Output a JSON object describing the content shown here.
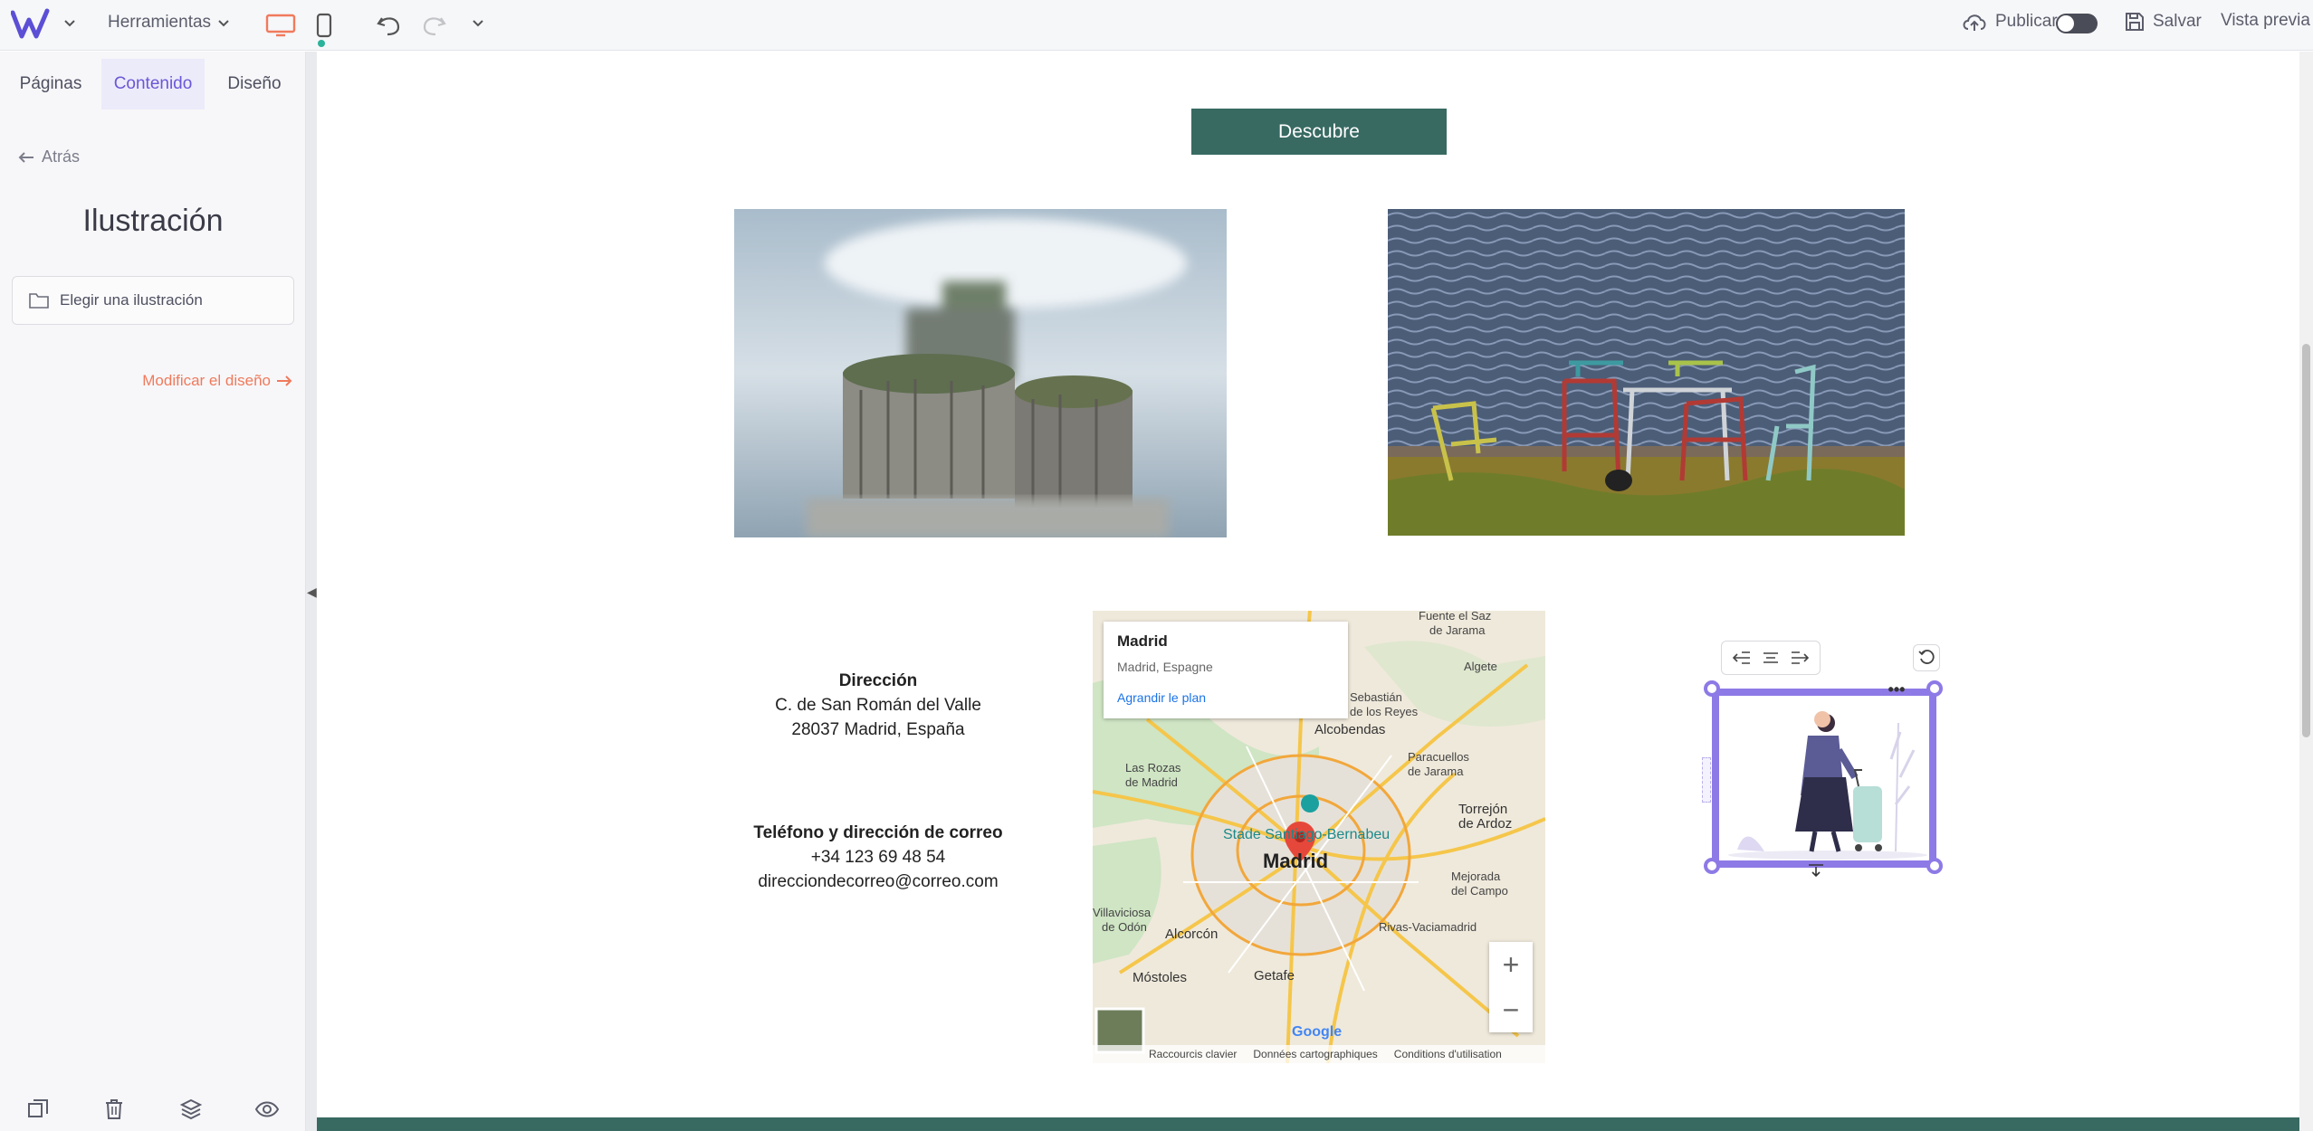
{
  "topbar": {
    "tools_label": "Herramientas",
    "publish_label": "Publicar",
    "save_label": "Salvar",
    "preview_label": "Vista previa"
  },
  "sidebar": {
    "tabs": [
      {
        "label": "Páginas",
        "active": false
      },
      {
        "label": "Contenido",
        "active": true
      },
      {
        "label": "Diseño",
        "active": false
      }
    ],
    "back_label": "Atrás",
    "title": "Ilustración",
    "choose_label": "Elegir una ilustración",
    "modify_label": "Modificar el diseño"
  },
  "page": {
    "discover_label": "Descubre",
    "address_title": "Dirección",
    "address_line1": "C. de San Román del Valle",
    "address_line2": "28037 Madrid, España",
    "contact_title": "Teléfono y dirección de correo",
    "phone": "+34 123 69 48 54",
    "email": "direcciondecorreo@correo.com"
  },
  "map": {
    "place": "Madrid",
    "place_sub": "Madrid, Espagne",
    "enlarge": "Agrandir le plan",
    "city_label": "Madrid",
    "stadium_label": "Stade Santiago-Bernabeu",
    "labels": [
      "Fuente el Saz de Jarama",
      "Algete",
      "Alcobendas",
      "Las Rozas de Madrid",
      "Paracuellos de Jarama",
      "Torrejón de Ardoz",
      "Mejorada del Campo",
      "Rivas-Vaciamadrid",
      "Alcorcón",
      "Móstoles",
      "Getafe",
      "Villaviciosa de Odón",
      "Sebastián de los Reyes"
    ],
    "footer": [
      "Raccourcis clavier",
      "Données cartographiques",
      "Conditions d'utilisation"
    ],
    "brand": "Google"
  },
  "colors": {
    "accent": "#6b57d6",
    "brand_green": "#386a62",
    "selection": "#8e7ae6",
    "orange": "#f07a5c"
  }
}
